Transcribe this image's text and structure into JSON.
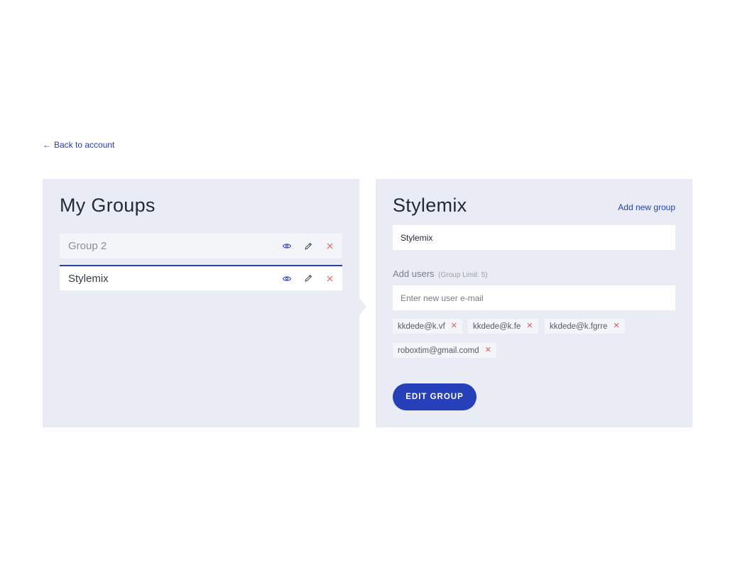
{
  "back_link": {
    "arrow": "←",
    "label": "Back to account"
  },
  "left_panel": {
    "title": "My Groups",
    "groups": [
      {
        "name": "Group 2",
        "active": false
      },
      {
        "name": "Stylemix",
        "active": true
      }
    ]
  },
  "right_panel": {
    "title": "Stylemix",
    "add_new_group": "Add new group",
    "group_name_value": "Stylemix",
    "add_users_label": "Add users",
    "group_limit": "(Group Limit: 5)",
    "email_placeholder": "Enter new user e-mail",
    "users": [
      "kkdede@k.vf",
      "kkdede@k.fe",
      "kkdede@k.fgrre",
      "roboxtim@gmail.comd"
    ],
    "remove_glyph": "✕",
    "edit_button": "EDIT GROUP"
  },
  "colors": {
    "accent": "#2540b8",
    "panel_bg": "#e9ecf5",
    "remove": "#e05a5a"
  }
}
